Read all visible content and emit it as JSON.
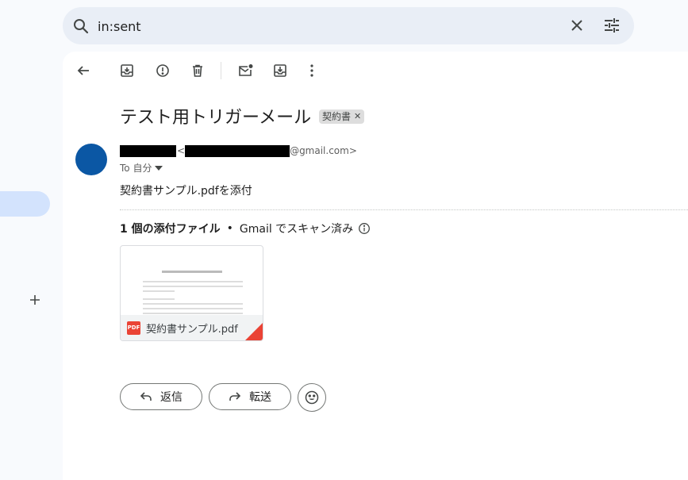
{
  "search": {
    "value": "in:sent"
  },
  "message": {
    "subject": "テスト用トリガーメール",
    "label": "契約書",
    "sender_address_suffix": "@gmail.com>",
    "to_line": "To 自分",
    "body": "契約書サンプル.pdfを添付"
  },
  "attachments": {
    "count_label": "1 個の添付ファイル",
    "separator": "•",
    "scan_label": "Gmail でスキャン済み",
    "items": [
      {
        "name": "契約書サンプル.pdf",
        "type_badge": "PDF"
      }
    ]
  },
  "actions": {
    "reply_label": "返信",
    "forward_label": "転送"
  },
  "icons": {
    "search": "search-icon",
    "clear": "close-icon",
    "tune": "tune-icon",
    "back": "arrow-back-icon",
    "archive": "archive-icon",
    "spam": "report-spam-icon",
    "delete": "trash-icon",
    "unread": "mark-unread-icon",
    "move": "move-to-icon",
    "more": "more-vert-icon",
    "compose_plus": "plus-icon",
    "emoji": "emoji-icon"
  },
  "colors": {
    "avatar": "#0b57a4",
    "active_nav": "#d3e3fd",
    "pdf_red": "#ea4335"
  }
}
